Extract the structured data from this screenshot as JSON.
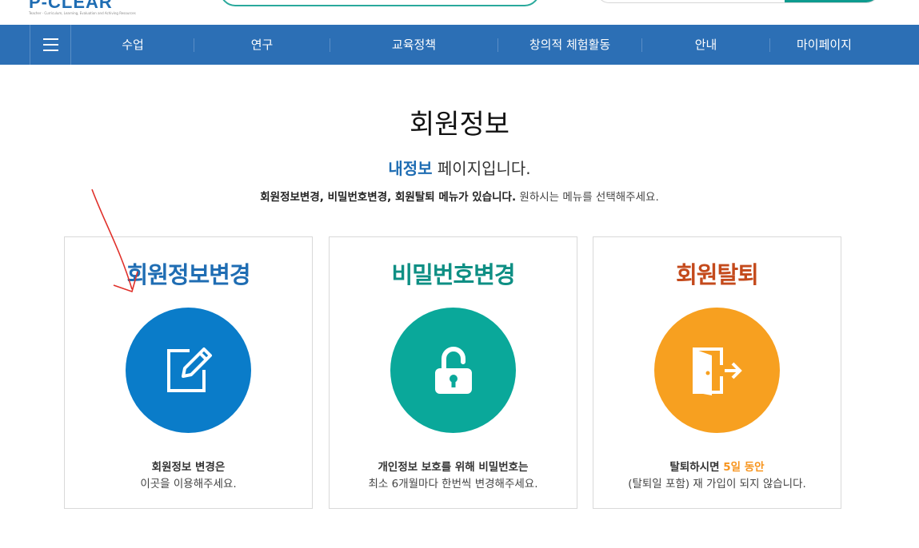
{
  "header": {
    "logo_text": "P-CLEAR",
    "logo_subtext": "Teacher · Curriculum, Learning, Evaluation and Achiving Resources"
  },
  "nav": {
    "items": [
      "수업",
      "연구",
      "교육정책",
      "창의적 체험활동",
      "안내",
      "마이페이지"
    ]
  },
  "page": {
    "title": "회원정보",
    "subtitle_highlight": "내정보",
    "subtitle_rest": " 페이지입니다.",
    "desc_bold": "회원정보변경, 비밀번호변경, 회원탈퇴 메뉴가 있습니다.",
    "desc_rest": " 원하시는 메뉴를 선택해주세요."
  },
  "cards": [
    {
      "title": "회원정보변경",
      "icon": "edit-icon",
      "color": "#0a7cc9",
      "title_color": "#1f6db3",
      "line1": "회원정보 변경은",
      "line2": "이곳을 이용해주세요."
    },
    {
      "title": "비밀번호변경",
      "icon": "unlock-icon",
      "color": "#0aa89a",
      "title_color": "#0e8f84",
      "line1": "개인정보 보호를 위해 비밀번호는",
      "line2": "최소 6개월마다 한번씩 변경해주세요."
    },
    {
      "title": "회원탈퇴",
      "icon": "exit-door-icon",
      "color": "#f7a020",
      "title_color": "#c44a1c",
      "line1_pre": "탈퇴하시면 ",
      "line1_accent": "5일 동안",
      "line2": "(탈퇴일 포함) 재 가입이 되지 않습니다."
    }
  ],
  "colors": {
    "nav_bg": "#2c6fb5",
    "accent_orange": "#f7941d",
    "annotation_red": "#e0302a"
  }
}
